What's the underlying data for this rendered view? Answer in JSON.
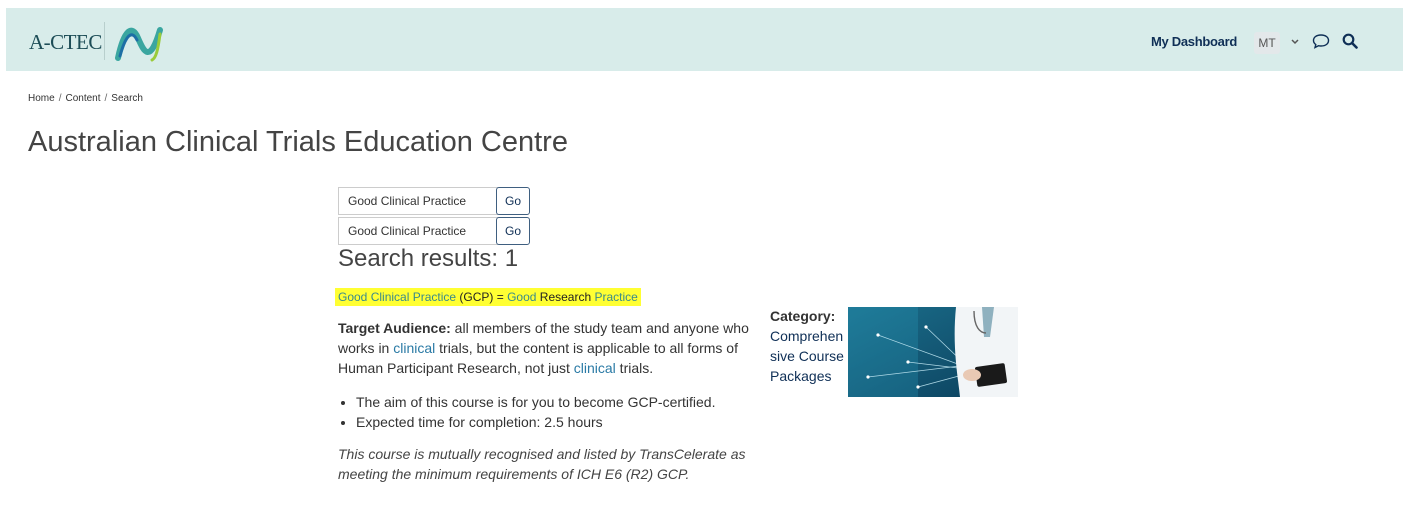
{
  "header": {
    "logo_text": "A-CTEC",
    "dashboard_link": "My Dashboard",
    "avatar_initials": "MT",
    "icons": [
      "wave-logo-icon",
      "chevron-down-icon",
      "chat-icon",
      "search-icon"
    ],
    "colors": {
      "header_bg": "#d8ecea",
      "nav_text": "#0f2f56"
    }
  },
  "breadcrumb": [
    "Home",
    "Content",
    "Search"
  ],
  "page_title": "Australian Clinical Trials Education Centre",
  "searches": [
    {
      "value": "Good Clinical Practice",
      "button": "Go"
    },
    {
      "value": "Good Clinical Practice",
      "button": "Go"
    }
  ],
  "results_heading": "Search results: 1",
  "result": {
    "title_parts": [
      "Good Clinical Practice",
      " (GCP) = ",
      "Good",
      " Research ",
      "Practice"
    ],
    "target_label": "Target Audience:",
    "desc_1": " all members of the study team and anyone who works in ",
    "kw_1": "clinical",
    "desc_2": " trials, but the content is applicable to all forms of Human Participant Research, not just ",
    "kw_2": "clinical",
    "desc_3": " trials.",
    "bullets": [
      "The aim of this course  is for you to become GCP-certified.",
      "Expected time for completion: 2.5 hours"
    ],
    "note": "This course is mutually recognised and listed by TransCelerate as meeting the minimum requirements of ICH E6 (R2) GCP.",
    "category_label": "Category:",
    "category_value": "Comprehensive Course Packages",
    "highlight_color": "#ffff33"
  }
}
